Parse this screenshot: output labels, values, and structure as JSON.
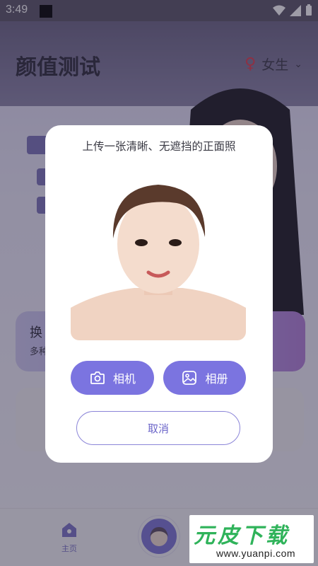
{
  "status_bar": {
    "time": "3:49"
  },
  "app": {
    "title": "颜值测试",
    "gender": {
      "symbol": "♀",
      "value": "女生",
      "chevron": "⌄"
    },
    "feature_card": {
      "title": "换",
      "subtitle": "多种"
    },
    "tabbar": {
      "home_label": "主页"
    }
  },
  "dialog": {
    "title": "上传一张清晰、无遮挡的正面照",
    "camera_label": "相机",
    "album_label": "相册",
    "cancel_label": "取消"
  },
  "watermark": {
    "brand": "元皮下载",
    "url": "www.yuanpi.com"
  },
  "colors": {
    "accent": "#7b74e0",
    "cancel_border": "#8b85d8",
    "brand_green": "#2fb35a"
  }
}
